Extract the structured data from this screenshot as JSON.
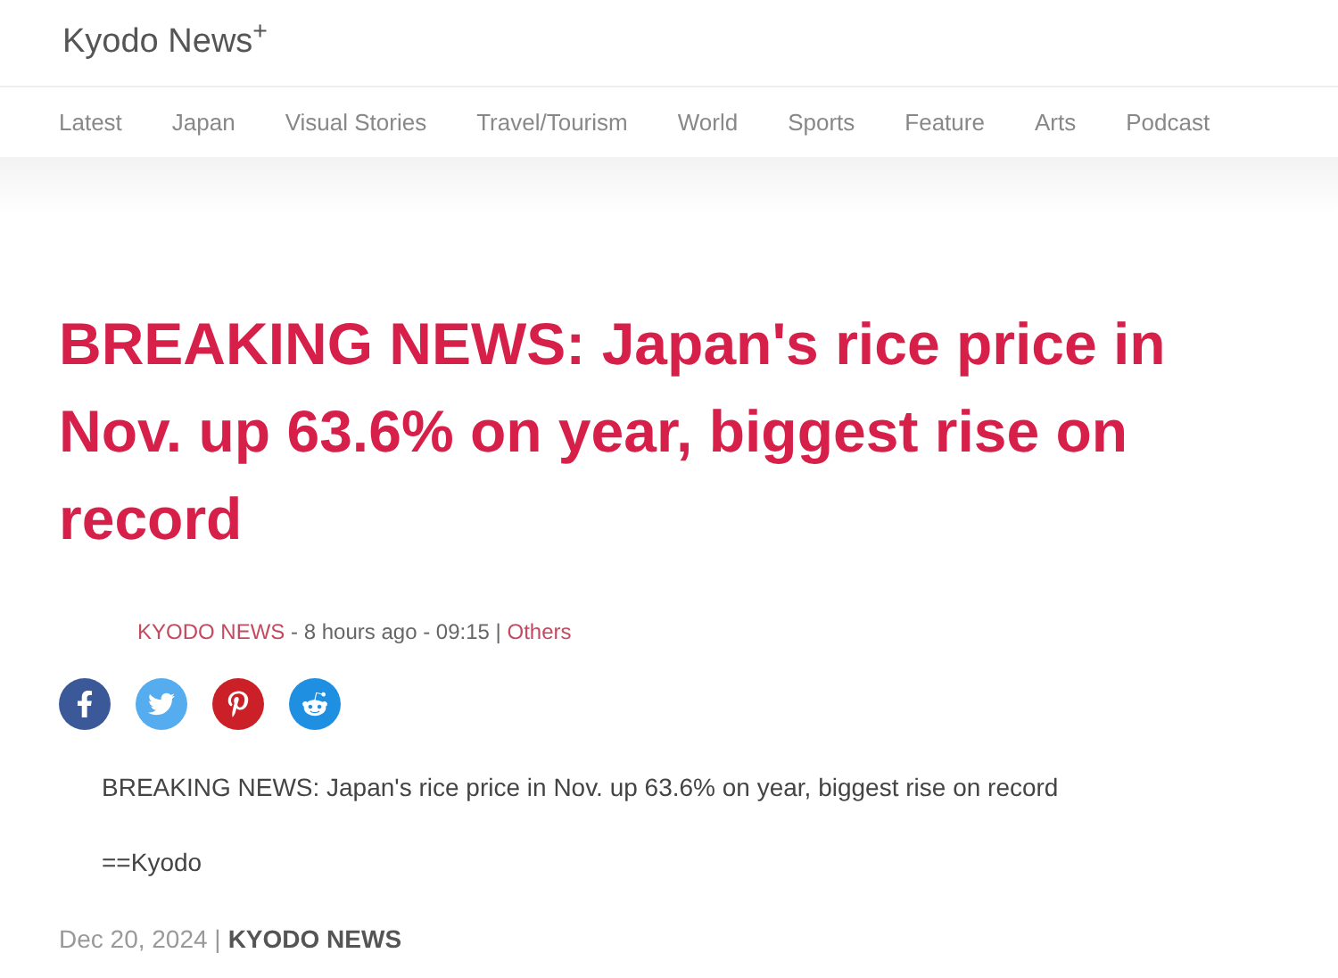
{
  "header": {
    "logo": "Kyodo News$^{+}$"
  },
  "nav": [
    {
      "label": "Latest"
    },
    {
      "label": "Japan"
    },
    {
      "label": "Visual Stories"
    },
    {
      "label": "Travel/Tourism"
    },
    {
      "label": "World"
    },
    {
      "label": "Sports"
    },
    {
      "label": "Feature"
    },
    {
      "label": "Arts"
    },
    {
      "label": "Podcast"
    }
  ],
  "article": {
    "headline": "BREAKING NEWS: Japan's rice price in Nov. up 63.6% on year, biggest rise on record",
    "byline": {
      "author": "KYODO NEWS",
      "time": "- 8 hours ago - 09:15 |",
      "category": "Others"
    },
    "share_buttons": [
      {
        "kind": "facebook"
      },
      {
        "kind": "twitter"
      },
      {
        "kind": "pinterest"
      },
      {
        "kind": "reddit"
      }
    ],
    "paragraphs": [
      "BREAKING NEWS: Japan's rice price in Nov. up 63.6% on year, biggest rise on record",
      "==Kyodo"
    ],
    "footer": {
      "date": "Dec 20, 2024 |",
      "source": "KYODO NEWS"
    }
  }
}
